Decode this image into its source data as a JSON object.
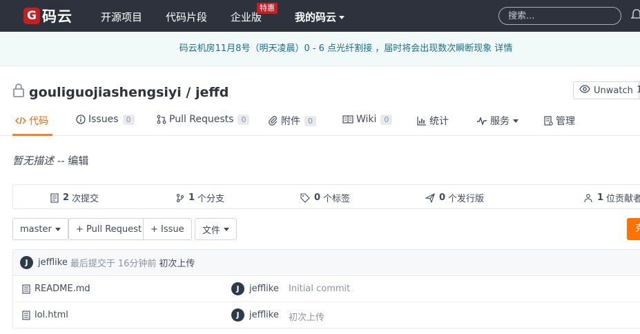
{
  "nav": {
    "logo_letter": "G",
    "logo_text": "码云",
    "links": [
      "开源项目",
      "代码片段",
      "企业版",
      "我的码云"
    ],
    "hot_badge": "特惠",
    "search_placeholder": "搜索...",
    "icons": {
      "bell": "bell-icon"
    }
  },
  "notice": {
    "text": "码云机房11月8号（明天凌晨）0 - 6 点光纤割接 ，届时将会出现数次瞬断现象",
    "link": "详情"
  },
  "repo": {
    "owner": "gouliguojiashengsiyi",
    "sep": " / ",
    "name": "jeffd",
    "watch_label": "Unwatch",
    "watch_count": "1"
  },
  "tabs": [
    {
      "label": "代码",
      "count": null,
      "icon": "code-icon"
    },
    {
      "label": "Issues",
      "count": "0",
      "icon": "info-icon"
    },
    {
      "label": "Pull Requests",
      "count": "0",
      "icon": "pull-request-icon"
    },
    {
      "label": "附件",
      "count": "0",
      "icon": "paperclip-icon"
    },
    {
      "label": "Wiki",
      "count": "0",
      "icon": "book-icon"
    },
    {
      "label": "统计",
      "count": null,
      "icon": "bar-chart-icon"
    },
    {
      "label": "服务",
      "count": null,
      "icon": "pulse-icon"
    },
    {
      "label": "管理",
      "count": null,
      "icon": "settings-doc-icon"
    }
  ],
  "description": {
    "empty": "暂无描述",
    "sep": " -- ",
    "edit": "编辑"
  },
  "stats": [
    {
      "num": "2",
      "label": "次提交",
      "icon": "commit-icon"
    },
    {
      "num": "1",
      "label": "个分支",
      "icon": "branch-icon"
    },
    {
      "num": "0",
      "label": "个标签",
      "icon": "tag-icon"
    },
    {
      "num": "0",
      "label": "个发行版",
      "icon": "release-icon"
    },
    {
      "num": "1",
      "label": "位贡献者",
      "icon": "contributors-icon"
    }
  ],
  "actions": {
    "branch": "master",
    "pull_request": "+ Pull Request",
    "issue": "+ Issue",
    "file": "文件",
    "orange": "克"
  },
  "commit": {
    "avatar": "J",
    "user": "jefflike",
    "text": "最后提交于",
    "time": "16分钟前",
    "message": "初次上传"
  },
  "files": [
    {
      "name": "README.md",
      "avatar": "J",
      "user": "jefflike",
      "message": "Initial commit"
    },
    {
      "name": "lol.html",
      "avatar": "J",
      "user": "jefflike",
      "message": "初次上传"
    }
  ]
}
